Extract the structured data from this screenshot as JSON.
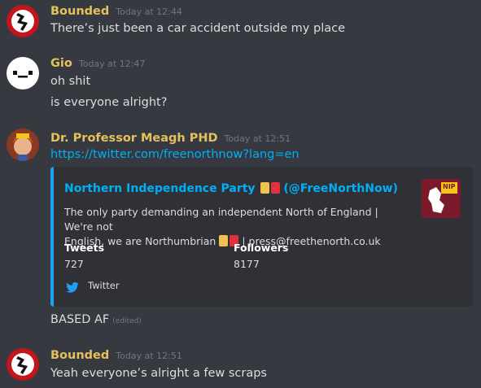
{
  "messages": [
    {
      "author": "Bounded",
      "time": "Today at 12:44",
      "lines": [
        "There’s just been a car accident outside my place"
      ]
    },
    {
      "author": "Gio",
      "time": "Today at 12:47",
      "lines": [
        "oh shit",
        "is everyone alright?"
      ]
    },
    {
      "author": "Dr. Professor Meagh PHD",
      "time": "Today at 12:51",
      "link": "https://twitter.com/freenorthnow?lang=en",
      "after_embed": "BASED AF",
      "edited_label": "(edited)"
    },
    {
      "author": "Bounded",
      "time": "Today at 12:51",
      "lines": [
        "Yeah everyone’s alright a few scraps"
      ]
    }
  ],
  "embed": {
    "title_name": "Northern Independence Party",
    "title_handle": "(@FreeNorthNow)",
    "desc_1": "The only party demanding an independent North of England | We're not",
    "desc_2a": "English, we are Northumbrian",
    "desc_2b": "| press@freethenorth.co.uk",
    "fields": [
      {
        "name": "Tweets",
        "value": "727"
      },
      {
        "name": "Followers",
        "value": "8177"
      }
    ],
    "footer": "Twitter",
    "thumb_text": "NIP",
    "accent": "#1da1f2"
  },
  "colors": {
    "username": "#e5c15b",
    "link": "#00b0f4",
    "background": "#36393f"
  }
}
